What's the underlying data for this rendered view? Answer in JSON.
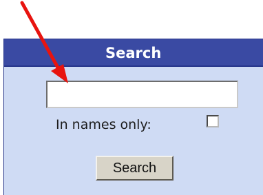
{
  "search_panel": {
    "title": "Search",
    "input_value": "",
    "input_placeholder": "",
    "names_only_label": "In names only:",
    "names_only_checked": false,
    "submit_label": "Search"
  },
  "annotation": {
    "arrow_icon": "red-arrow-icon",
    "points_to": "search-input"
  },
  "colors": {
    "header_bg": "#3a4aa3",
    "panel_bg": "#cfdbf4",
    "arrow": "#e8140f",
    "button_bg": "#d8d4c8"
  }
}
